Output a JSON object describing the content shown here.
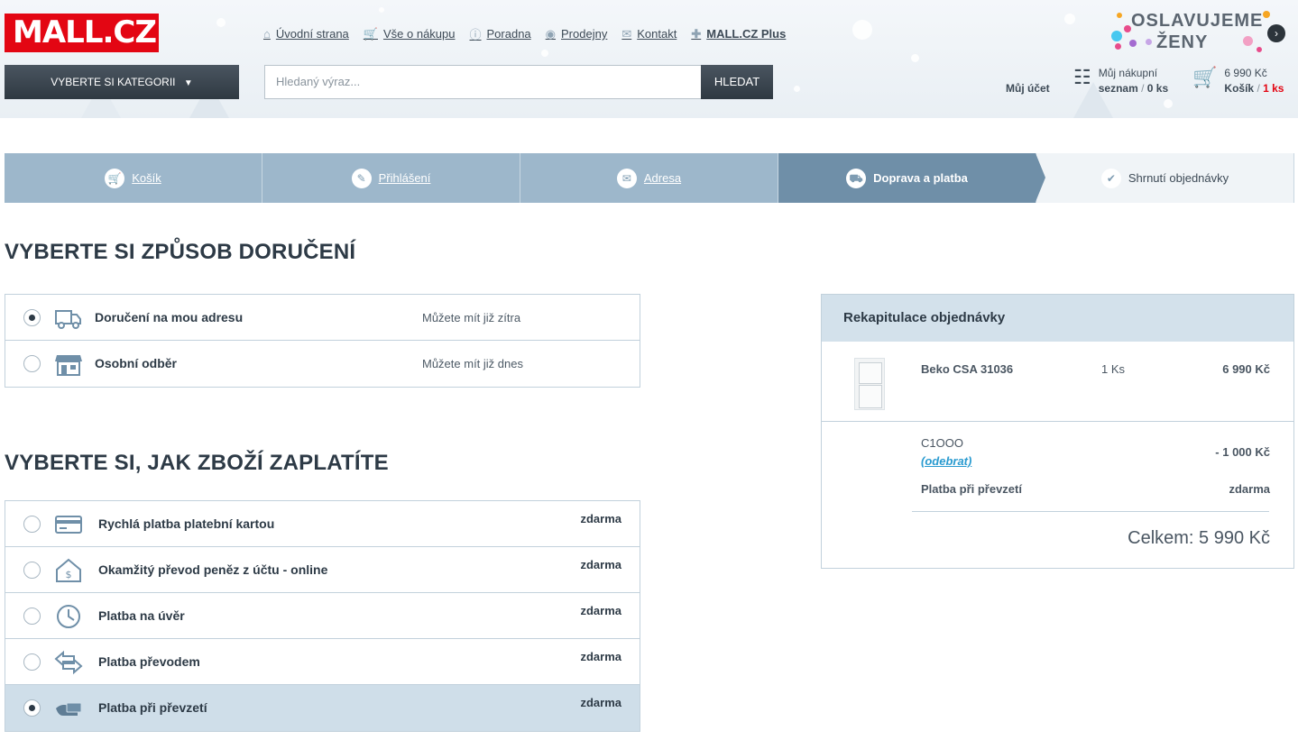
{
  "header": {
    "logo": "MALL.CZ",
    "nav": [
      {
        "label": "Úvodní strana",
        "icon": "home-icon",
        "glyph": "⌂"
      },
      {
        "label": "Vše o nákupu",
        "icon": "cart-icon",
        "glyph": "🛒"
      },
      {
        "label": "Poradna",
        "icon": "info-icon",
        "glyph": "ⓘ"
      },
      {
        "label": "Prodejny",
        "icon": "store-icon",
        "glyph": "◉"
      },
      {
        "label": "Kontakt",
        "icon": "mail-icon",
        "glyph": "✉"
      },
      {
        "label": "MALL.CZ Plus",
        "icon": "plus-icon",
        "glyph": "✚"
      }
    ],
    "category_button": "VYBERTE SI KATEGORII",
    "search_placeholder": "Hledaný výraz...",
    "search_button": "HLEDAT",
    "promo_line1": "OSLAVUJEME",
    "promo_line2": "ŽENY",
    "account_label": "Můj účet",
    "wishlist_line1": "Můj nákupní",
    "wishlist_label": "seznam",
    "wishlist_sep": "/",
    "wishlist_count": "0 ks",
    "cart_price": "6 990 Kč",
    "cart_label": "Košík",
    "cart_sep": "/",
    "cart_count": "1 ks"
  },
  "steps": [
    {
      "label": "Košík",
      "icon": "cart-icon",
      "glyph": "🛒"
    },
    {
      "label": "Přihlášení",
      "icon": "pencil-icon",
      "glyph": "✎"
    },
    {
      "label": "Adresa",
      "icon": "envelope-icon",
      "glyph": "✉"
    },
    {
      "label": "Doprava a platba",
      "icon": "truck-icon",
      "glyph": "⛟"
    },
    {
      "label": "Shrnutí objednávky",
      "icon": "check-icon",
      "glyph": "✔"
    }
  ],
  "delivery": {
    "heading": "VYBERTE SI ZPŮSOB DORUČENÍ",
    "options": [
      {
        "label": "Doručení na mou adresu",
        "note": "Můžete mít již zítra",
        "selected": true
      },
      {
        "label": "Osobní odběr",
        "note": "Můžete mít již dnes",
        "selected": false
      }
    ]
  },
  "payment": {
    "heading": "VYBERTE SI, JAK ZBOŽÍ ZAPLATÍTE",
    "options": [
      {
        "label": "Rychlá platba platební kartou",
        "price": "zdarma",
        "selected": false
      },
      {
        "label": "Okamžitý převod peněz z účtu - online",
        "price": "zdarma",
        "selected": false
      },
      {
        "label": "Platba na úvěr",
        "price": "zdarma",
        "selected": false
      },
      {
        "label": "Platba převodem",
        "price": "zdarma",
        "selected": false
      },
      {
        "label": "Platba při převzetí",
        "price": "zdarma",
        "selected": true
      }
    ]
  },
  "summary": {
    "title": "Rekapitulace objednávky",
    "product_name": "Beko CSA 31036",
    "product_qty": "1 Ks",
    "product_price": "6 990 Kč",
    "voucher_code": "C1OOO",
    "voucher_remove": "(odebrat)",
    "voucher_discount": "- 1 000 Kč",
    "payment_label": "Platba při převzetí",
    "payment_price": "zdarma",
    "total": "Celkem: 5 990 Kč"
  },
  "colors": {
    "brand_red": "#e30613",
    "steps_blue": "#9db7cb",
    "steps_active": "#6f8fa8",
    "link_blue": "#2a9bd0"
  }
}
